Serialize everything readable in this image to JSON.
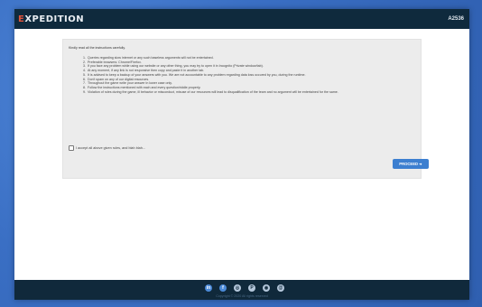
{
  "header": {
    "brand_first_letter": "E",
    "brand_rest": "XPEDITION",
    "team_id": "A2536"
  },
  "rules_panel": {
    "intro": "Kindly read all the instructions carefully.",
    "rules": [
      "Queries regarding slow internet or any such baseless arguments will not be entertained.",
      "Preferable browsers: Chrome/Firefox.",
      "If you face any problem while using our website or any other thing, you may try to open it in Incognito (Private window/tab).",
      "At any moment, if any link is not responsive then copy and paste it in another tab.",
      "It is advised to keep a backup of your answers with you. We are not accountable to any problem regarding data loss occured by you, during the runtime.",
      "Don't spam on any of our digital resources.",
      "Throughout the game write your answer in lower case only.",
      "Follow the instructions mentioned with each and every question/riddle properly.",
      "Violation of rules during the game, ill behavior or misconduct, misuse of our resources will lead to disqualification of the team and no argument will be entertained for the same."
    ],
    "accept_label": "I accept all above given rules, and blah blah...",
    "accept_checked": false,
    "proceed_label": "PROCEED ➜"
  },
  "footer": {
    "social_icons": [
      {
        "icon": "linkedin-icon",
        "glyph": "in"
      },
      {
        "icon": "facebook-icon",
        "glyph": "f"
      },
      {
        "icon": "instagram-icon",
        "glyph": "◎"
      },
      {
        "icon": "pinterest-icon",
        "glyph": "P"
      },
      {
        "icon": "website-icon",
        "glyph": "◉"
      },
      {
        "icon": "email-icon",
        "glyph": "@"
      }
    ],
    "copyright": "Copyright © 2020 All rights reserved"
  }
}
